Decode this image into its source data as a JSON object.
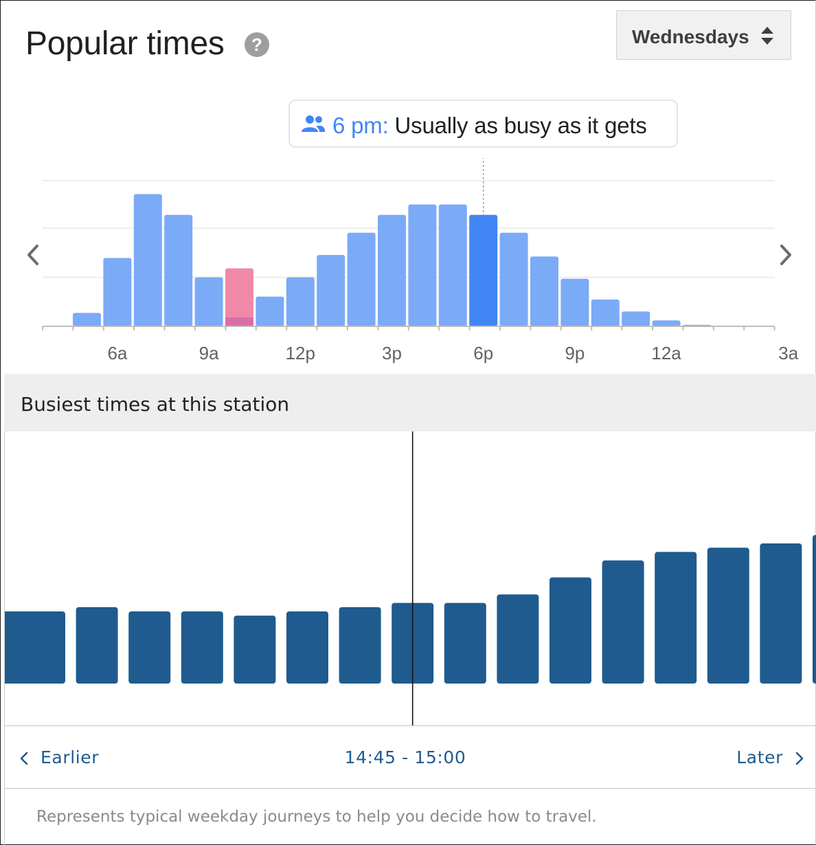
{
  "popular_times": {
    "title": "Popular times",
    "help_icon": "help-icon",
    "help_glyph": "?",
    "day_selector": {
      "value": "Wednesdays",
      "icon": "up-down-icon"
    },
    "tooltip": {
      "icon": "people-icon",
      "time": "6 pm:",
      "text": "Usually as busy as it gets"
    },
    "prev_icon": "chevron-left-icon",
    "next_icon": "chevron-right-icon",
    "colors": {
      "bar": "#7baaf7",
      "highlight": "#4285f4",
      "live": "#f088a8",
      "live_overlap": "#d96fa8"
    }
  },
  "chart_data": [
    {
      "type": "bar",
      "title": "Popular times",
      "x_tick_labels": [
        "6a",
        "9a",
        "12p",
        "3p",
        "6p",
        "9p",
        "12a",
        "3a"
      ],
      "categories": [
        "5a",
        "6a",
        "7a",
        "8a",
        "9a",
        "10a",
        "11a",
        "12p",
        "1p",
        "2p",
        "3p",
        "4p",
        "5p",
        "6p",
        "7p",
        "8p",
        "9p",
        "10p",
        "11p",
        "12a",
        "1a",
        "2a"
      ],
      "values": [
        9,
        46,
        89,
        75,
        33,
        6,
        20,
        33,
        48,
        63,
        75,
        82,
        82,
        75,
        63,
        47,
        32,
        18,
        10,
        4,
        1,
        0
      ],
      "ylim": [
        0,
        98
      ],
      "gridlines": [
        33,
        66,
        98
      ],
      "selected_category": "6p",
      "live": {
        "category": "10a",
        "value": 39
      }
    },
    {
      "type": "bar",
      "title": "Busiest times at this station",
      "values": [
        17,
        17,
        18,
        17,
        17,
        16,
        17,
        18,
        19,
        19,
        21,
        25,
        29,
        31,
        32,
        33,
        35
      ],
      "ylim": [
        0,
        100
      ],
      "current_marker_after_bar": 8,
      "bar_color": "#1f5b8f"
    }
  ],
  "busiest": {
    "title": "Busiest times at this station",
    "earlier": "Earlier",
    "later": "Later",
    "time_range": "14:45 - 15:00",
    "earlier_icon": "chevron-left-icon",
    "later_icon": "chevron-right-icon",
    "footnote": "Represents typical weekday journeys to help you decide how to travel."
  }
}
